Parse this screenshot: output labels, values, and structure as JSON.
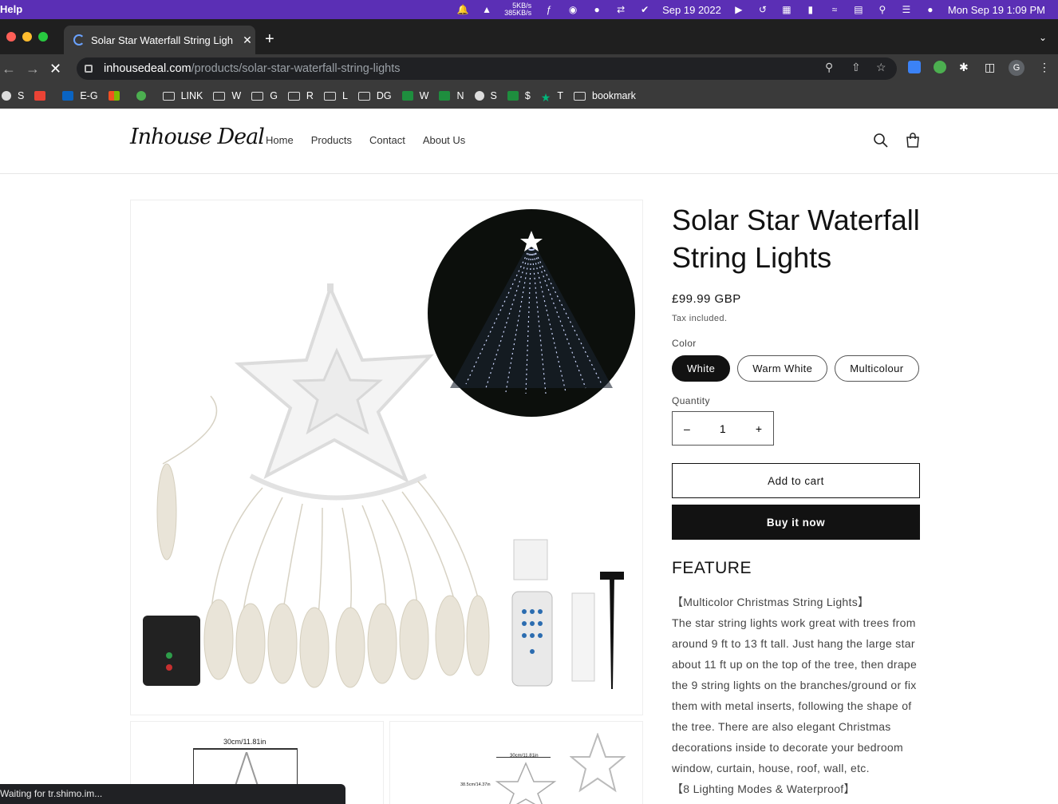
{
  "menubar": {
    "app_menu": "Help",
    "net_up": "5KB/s",
    "net_down": "385KB/s",
    "date_short": "Sep 19 2022",
    "clock": "Mon Sep 19  1:09 PM"
  },
  "browser": {
    "tab_title": "Solar Star Waterfall String Ligh",
    "url_host": "inhousedeal.com",
    "url_path": "/products/solar-star-waterfall-string-lights",
    "avatar_initial": "G",
    "bookmarks": [
      "S",
      "",
      "E-G",
      "",
      "",
      "LINK",
      "W",
      "G",
      "R",
      "L",
      "DG",
      "W",
      "N",
      "S",
      "$",
      "T",
      "bookmark"
    ],
    "status_text": "Waiting for tr.shimo.im..."
  },
  "store": {
    "logo": "Inhouse Deal",
    "nav": [
      "Home",
      "Products",
      "Contact",
      "About Us"
    ]
  },
  "product": {
    "title": "Solar Star Waterfall String Lights",
    "price": "£99.99 GBP",
    "tax_note": "Tax included.",
    "color_label": "Color",
    "colors": [
      "White",
      "Warm White",
      "Multicolour"
    ],
    "selected_color": "White",
    "quantity_label": "Quantity",
    "quantity": "1",
    "add_to_cart": "Add to cart",
    "buy_now": "Buy it now",
    "feature_heading": "FEATURE",
    "feature_1_title": "【Multicolor Christmas String Lights】",
    "feature_1_text": "The star string lights work great with trees from around 9 ft to 13 ft tall. Just hang the large star about 11 ft up on the top of the tree, then drape the 9 string lights on the branches/ground or fix them with metal inserts, following the shape of the tree. There are also elegant Christmas decorations inside to decorate your bedroom window, curtain, house, roof, wall, etc.",
    "feature_2_title": "【8 Lighting Modes & Waterproof】",
    "thumb_1_dim": "30cm/11.81in",
    "thumb_2_dim_w": "30cm/11.81in",
    "thumb_2_dim_h": "38.5cm/14.37in"
  },
  "colors": {
    "menubar": "#5b2fb5",
    "chrome_dark": "#1f1f1f",
    "button_dark": "#121212"
  }
}
